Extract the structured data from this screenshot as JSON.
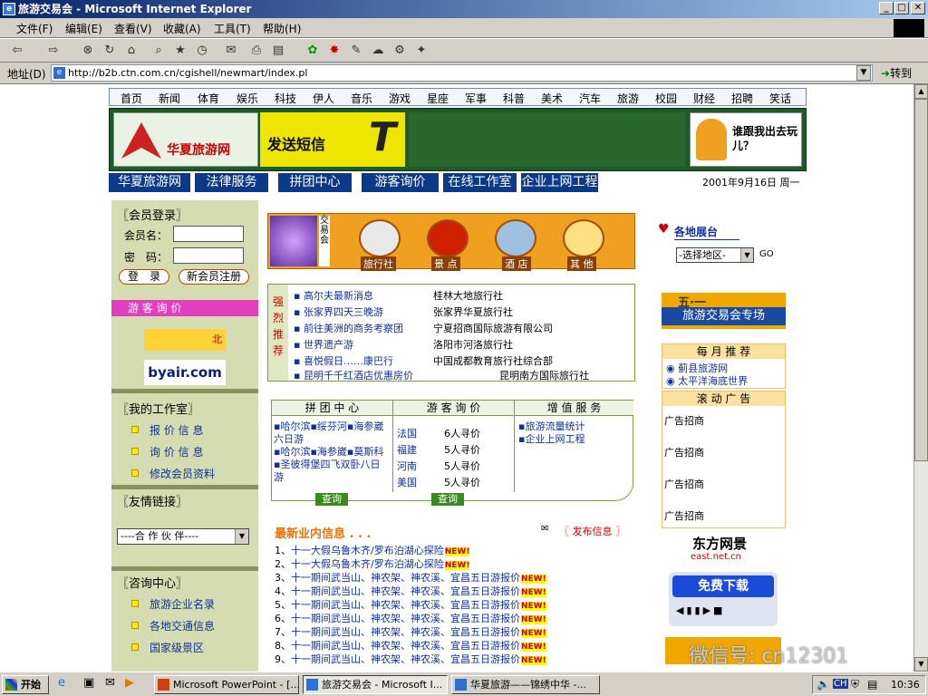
{
  "window": {
    "title": "旅游交易会 - Microsoft Internet Explorer",
    "min": "_",
    "max": "□",
    "close": "✕"
  },
  "menu": [
    "文件(F)",
    "编辑(E)",
    "查看(V)",
    "收藏(A)",
    "工具(T)",
    "帮助(H)"
  ],
  "address": {
    "label": "地址(D)",
    "url": "http://b2b.ctn.com.cn/cgishell/newmart/index.pl",
    "go": "转到"
  },
  "topnav": [
    "首页",
    "新闻",
    "体育",
    "娱乐",
    "科技",
    "伊人",
    "音乐",
    "游戏",
    "星座",
    "军事",
    "科普",
    "美术",
    "汽车",
    "旅游",
    "校园",
    "财经",
    "招聘",
    "笑话"
  ],
  "banner": {
    "logo": "华夏旅游网",
    "sms": "发送短信",
    "sms_letter": "T",
    "go_text": "谁跟我出去玩儿？"
  },
  "secnav": {
    "items": [
      "华夏旅游网",
      "法律服务",
      "拼团中心",
      "游客询价",
      "在线工作室",
      "企业上网工程"
    ],
    "date": "2001年9月16日 周一"
  },
  "left": {
    "login_title": "〖会员登录〗",
    "member_label": "会员名：",
    "password_label": "密　码：",
    "login_btn": "登　录",
    "register_btn": "新会员注册",
    "inquiry_bar": "游 客 询 价",
    "ad1": "北",
    "ad2": "byair.com",
    "studio_title": "〖我的工作室〗",
    "studio_items": [
      "报 价 信 息",
      "询 价 信 息",
      "修改会员资料"
    ],
    "links_title": "〖友情链接〗",
    "partner_select": "----合 作 伙 伴----",
    "consult_title": "〖咨询中心〗",
    "consult_items": [
      "旅游企业名录",
      "各地交通信息",
      "国家级景区"
    ]
  },
  "mid": {
    "market_label": "交易会",
    "cats": [
      "旅行社",
      "景 点",
      "酒 店",
      "其 他"
    ],
    "strong_label": "强烈推荐",
    "rec_left": [
      "高尔夫最新消息",
      "张家界四天三晚游",
      "前往美洲的商务考察团",
      "世界遗产游",
      "喜悦假日……康巴行",
      "昆明千千红酒店优惠房价"
    ],
    "rec_right": [
      "桂林大地旅行社",
      "张家界华夏旅行社",
      "宁夏招商国际旅游有限公司",
      "洛阳市河洛旅行社",
      "中国成都教育旅行社综合部",
      "昆明南方国际旅行社"
    ],
    "tabs": [
      "拼 团 中 心",
      "游 客 询 价",
      "增 值 服 务"
    ],
    "group_text": [
      "▪哈尔滨▪绥芬河▪海参崴六日游",
      "▪哈尔滨▪海参崴▪莫斯科▪圣彼得堡四飞双卧八日游"
    ],
    "inquiry": [
      {
        "place": "法国",
        "count": "6人寻价"
      },
      {
        "place": "福建",
        "count": "5人寻价"
      },
      {
        "place": "河南",
        "count": "5人寻价"
      },
      {
        "place": "美国",
        "count": "5人寻价"
      }
    ],
    "value_items": [
      "▪旅游流量统计",
      "▪企业上网工程"
    ],
    "query_btn": "查询",
    "news_title": "最新业内信息 . . .",
    "publish": "〖 发布信息 〗",
    "news": [
      {
        "n": "1、",
        "t": "十一大假乌鲁木齐/罗布泊湖心探险"
      },
      {
        "n": "2、",
        "t": "十一大假乌鲁木齐/罗布泊湖心探险"
      },
      {
        "n": "3、",
        "t": "十一期间武当山、神农架、神农溪、宜昌五日游报价"
      },
      {
        "n": "4、",
        "t": "十一期间武当山、神农架、神农溪、宜昌五日游报价"
      },
      {
        "n": "5、",
        "t": "十一期间武当山、神农架、神农溪、宜昌五日游报价"
      },
      {
        "n": "6、",
        "t": "十一期间武当山、神农架、神农溪、宜昌五日游报价"
      },
      {
        "n": "7、",
        "t": "十一期间武当山、神农架、神农溪、宜昌五日游报价"
      },
      {
        "n": "8、",
        "t": "十一期间武当山、神农架、神农溪、宜昌五日游报价"
      },
      {
        "n": "9、",
        "t": "十一期间武当山、神农架、神农溪、宜昌五日游报价"
      }
    ],
    "new_badge": "NEW!"
  },
  "right": {
    "region_title": "各地展台",
    "region_select": "-选择地区-",
    "go": "GO",
    "expo_top": "五·一",
    "expo": "旅游交易会专场",
    "monthly_title": "每 月 推 荐",
    "monthly": [
      "蓟县旅游网",
      "太平洋海底世界"
    ],
    "scroll_title": "滚 动 广 告",
    "ads": [
      "广告招商",
      "广告招商",
      "广告招商",
      "广告招商"
    ],
    "east": "东方网景",
    "east_sub": "east.net.cn",
    "download": "免费下载"
  },
  "taskbar": {
    "start": "开始",
    "tasks": [
      "Microsoft PowerPoint - [...",
      "旅游交易会 - Microsoft I...",
      "华夏旅游——锦绣中华 -..."
    ],
    "ime": "CH",
    "time": "10:36",
    "watermark": "微信号: cn12301"
  }
}
